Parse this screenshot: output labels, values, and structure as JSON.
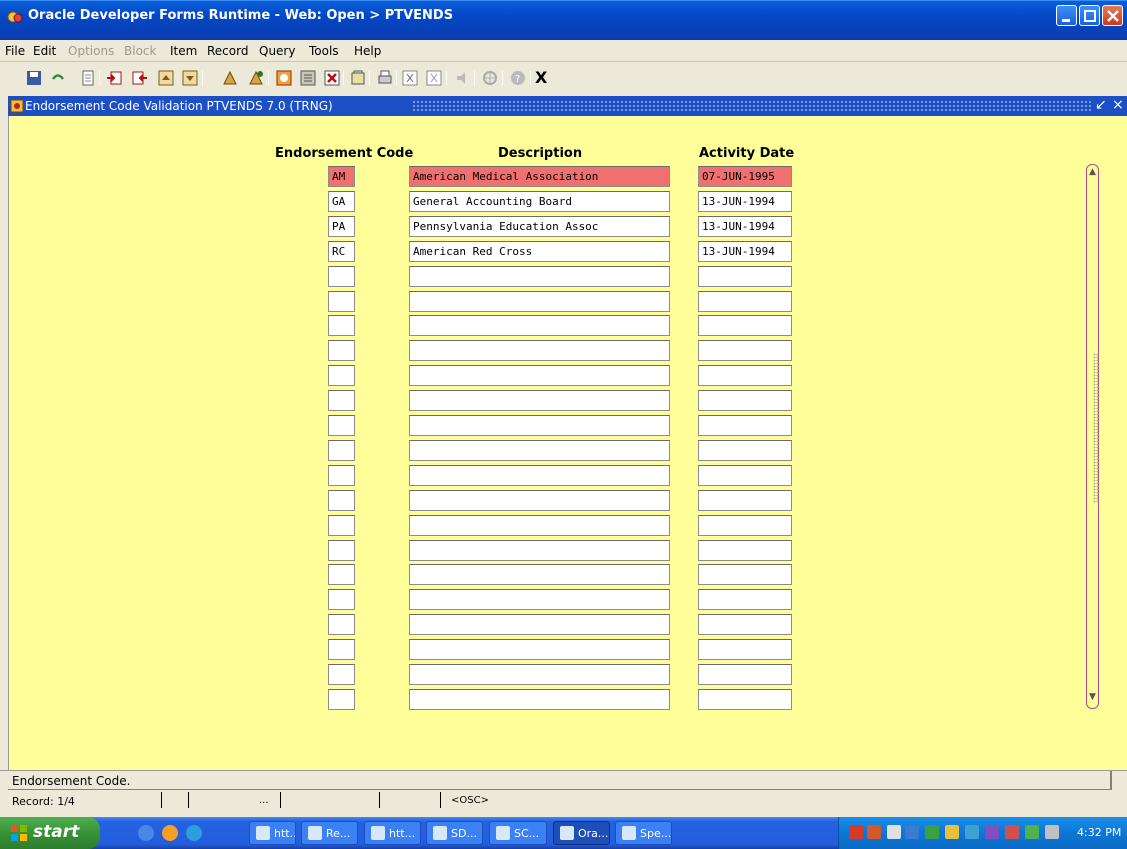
{
  "window": {
    "title": "Oracle Developer Forms Runtime - Web:  Open > PTVENDS"
  },
  "menu": [
    {
      "label": "File",
      "disabled": false
    },
    {
      "label": "Edit",
      "disabled": false
    },
    {
      "label": "Options",
      "disabled": true
    },
    {
      "label": "Block",
      "disabled": true
    },
    {
      "label": "Item",
      "disabled": false
    },
    {
      "label": "Record",
      "disabled": false
    },
    {
      "label": "Query",
      "disabled": false
    },
    {
      "label": "Tools",
      "disabled": false
    },
    {
      "label": "Help",
      "disabled": false
    }
  ],
  "toolbar": {
    "exit_label": "X"
  },
  "form_window": {
    "title": "Endorsement Code Validation  PTVENDS  7.0  (TRNG)"
  },
  "columns": {
    "code": "Endorsement Code",
    "description": "Description",
    "activity_date": "Activity Date"
  },
  "rows": [
    {
      "code": "AM",
      "description": "American Medical Association",
      "date": "07-JUN-1995"
    },
    {
      "code": "GA",
      "description": "General Accounting Board",
      "date": "13-JUN-1994"
    },
    {
      "code": "PA",
      "description": "Pennsylvania Education Assoc",
      "date": "13-JUN-1994"
    },
    {
      "code": "RC",
      "description": "American Red Cross",
      "date": "13-JUN-1994"
    },
    {
      "code": "",
      "description": "",
      "date": ""
    },
    {
      "code": "",
      "description": "",
      "date": ""
    },
    {
      "code": "",
      "description": "",
      "date": ""
    },
    {
      "code": "",
      "description": "",
      "date": ""
    },
    {
      "code": "",
      "description": "",
      "date": ""
    },
    {
      "code": "",
      "description": "",
      "date": ""
    },
    {
      "code": "",
      "description": "",
      "date": ""
    },
    {
      "code": "",
      "description": "",
      "date": ""
    },
    {
      "code": "",
      "description": "",
      "date": ""
    },
    {
      "code": "",
      "description": "",
      "date": ""
    },
    {
      "code": "",
      "description": "",
      "date": ""
    },
    {
      "code": "",
      "description": "",
      "date": ""
    },
    {
      "code": "",
      "description": "",
      "date": ""
    },
    {
      "code": "",
      "description": "",
      "date": ""
    },
    {
      "code": "",
      "description": "",
      "date": ""
    },
    {
      "code": "",
      "description": "",
      "date": ""
    },
    {
      "code": "",
      "description": "",
      "date": ""
    },
    {
      "code": "",
      "description": "",
      "date": ""
    }
  ],
  "selected_row": 0,
  "status": {
    "message": "Endorsement Code.",
    "record": "Record: 1/4",
    "dots": "...",
    "osc": "<OSC>"
  },
  "taskbar": {
    "start_label": "start",
    "tasks": [
      {
        "label": "htt...",
        "active": false
      },
      {
        "label": "Re...",
        "active": false
      },
      {
        "label": "htt...",
        "active": false
      },
      {
        "label": "SD...",
        "active": false
      },
      {
        "label": "SC...",
        "active": false
      },
      {
        "label": "Ora...",
        "active": true
      },
      {
        "label": "Spe...",
        "active": false
      }
    ],
    "clock": "4:32 PM"
  },
  "colors": {
    "form_bg": "#ffff99",
    "selected_cell": "#f07070",
    "title_blue": "#0447c6"
  }
}
